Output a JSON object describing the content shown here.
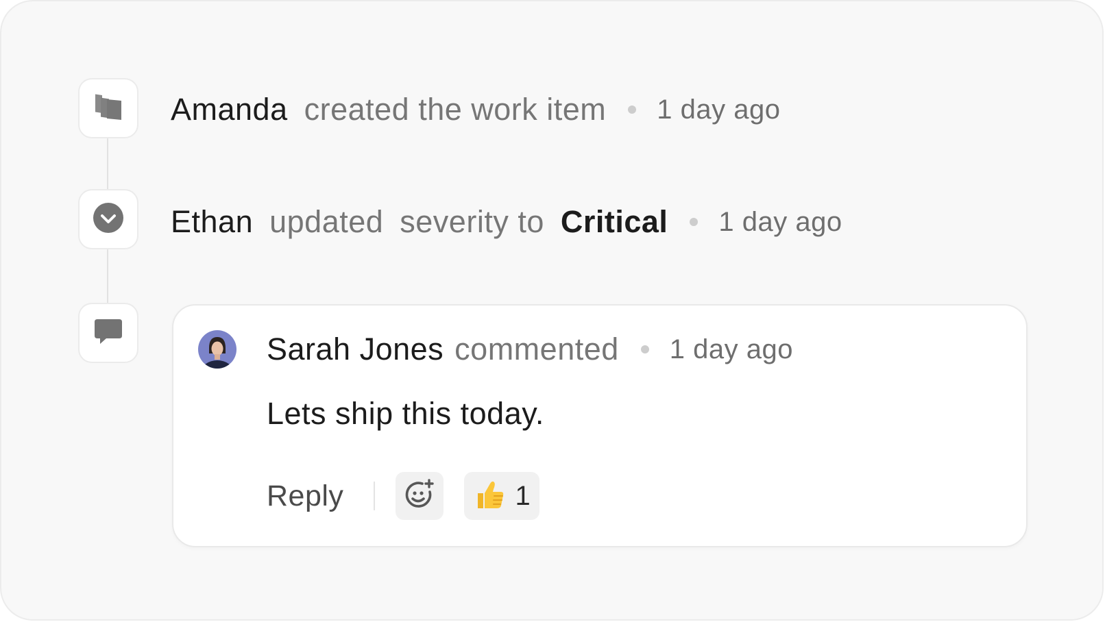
{
  "activity": [
    {
      "icon": "work-item-icon",
      "actor": "Amanda",
      "action": "created the work item",
      "time": "1 day ago"
    },
    {
      "icon": "chevron-down-circle-icon",
      "actor": "Ethan",
      "action": "updated",
      "field": "severity to",
      "value": "Critical",
      "time": "1 day ago"
    }
  ],
  "comment": {
    "icon": "comment-icon",
    "author": "Sarah Jones",
    "action": "commented",
    "time": "1 day ago",
    "body": "Lets ship this today.",
    "reply_label": "Reply",
    "add_reaction_icon": "add-emoji-icon",
    "reactions": [
      {
        "emoji": "👍",
        "count": "1"
      }
    ]
  },
  "colors": {
    "background": "#f8f8f8",
    "card": "#ffffff",
    "text_primary": "#1c1c1c",
    "text_muted": "#767676",
    "icon_gray": "#7d7d7d",
    "reaction_bg": "#f1f1f1"
  }
}
